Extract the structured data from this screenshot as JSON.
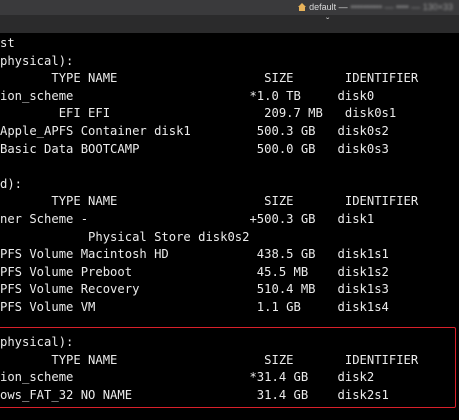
{
  "window": {
    "title_prefix": "default —",
    "title_blurred": "•••••••••• — •••• — 130×33",
    "icon": "house-icon",
    "tab_close": "ˇ"
  },
  "terminal": {
    "lines": [
      "st",
      "physical):",
      "       TYPE NAME                    SIZE       IDENTIFIER",
      "ion_scheme                        *1.0 TB     disk0",
      "        EFI EFI                     209.7 MB   disk0s1",
      "Apple_APFS Container disk1         500.3 GB   disk0s2",
      "Basic Data BOOTCAMP                500.0 GB   disk0s3",
      "",
      "d):",
      "       TYPE NAME                    SIZE       IDENTIFIER",
      "ner Scheme -                      +500.3 GB   disk1",
      "            Physical Store disk0s2",
      "PFS Volume Macintosh HD            438.5 GB   disk1s1",
      "PFS Volume Preboot                 45.5 MB    disk1s2",
      "PFS Volume Recovery                510.4 MB   disk1s3",
      "PFS Volume VM                      1.1 GB     disk1s4",
      "",
      "",
      "physical):",
      "       TYPE NAME                    SIZE       IDENTIFIER",
      "ion_scheme                        *31.4 GB    disk2",
      "ows_FAT_32 NO NAME                 31.4 GB    disk2s1"
    ]
  },
  "colors": {
    "background": "#000000",
    "text": "#ececec",
    "highlight": "#d8202a"
  }
}
